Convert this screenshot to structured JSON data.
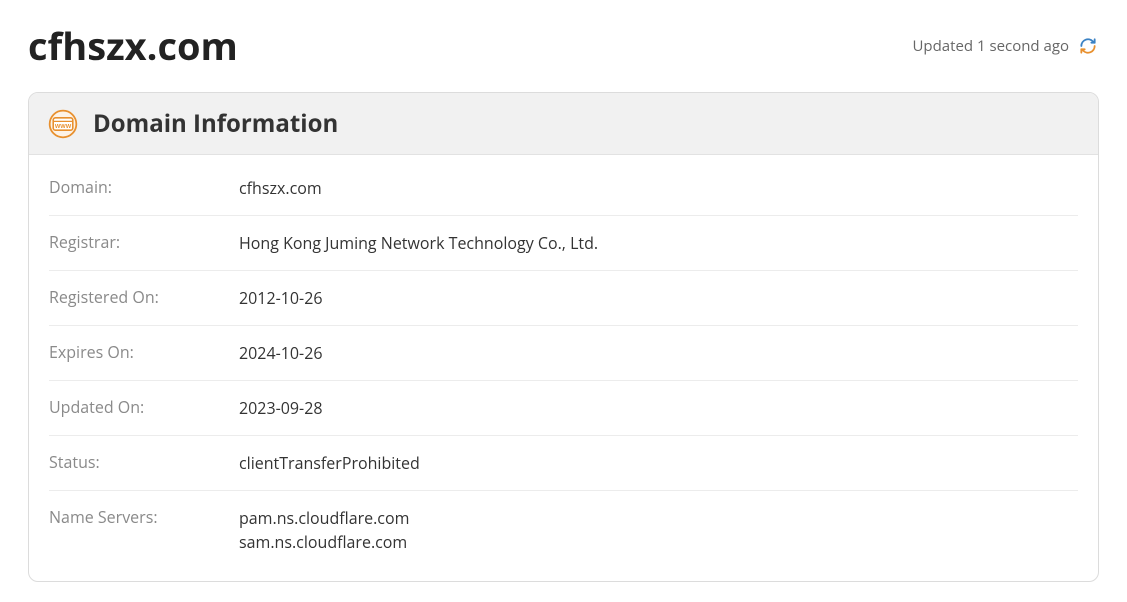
{
  "header": {
    "domain_title": "cfhszx.com",
    "updated_text": "Updated 1 second ago"
  },
  "panel": {
    "title": "Domain Information"
  },
  "info": {
    "domain_label": "Domain:",
    "domain_value": "cfhszx.com",
    "registrar_label": "Registrar:",
    "registrar_value": "Hong Kong Juming Network Technology Co., Ltd.",
    "registered_on_label": "Registered On:",
    "registered_on_value": "2012-10-26",
    "expires_on_label": "Expires On:",
    "expires_on_value": "2024-10-26",
    "updated_on_label": "Updated On:",
    "updated_on_value": "2023-09-28",
    "status_label": "Status:",
    "status_value": "clientTransferProhibited",
    "name_servers_label": "Name Servers:",
    "name_servers_1": "pam.ns.cloudflare.com",
    "name_servers_2": "sam.ns.cloudflare.com"
  }
}
